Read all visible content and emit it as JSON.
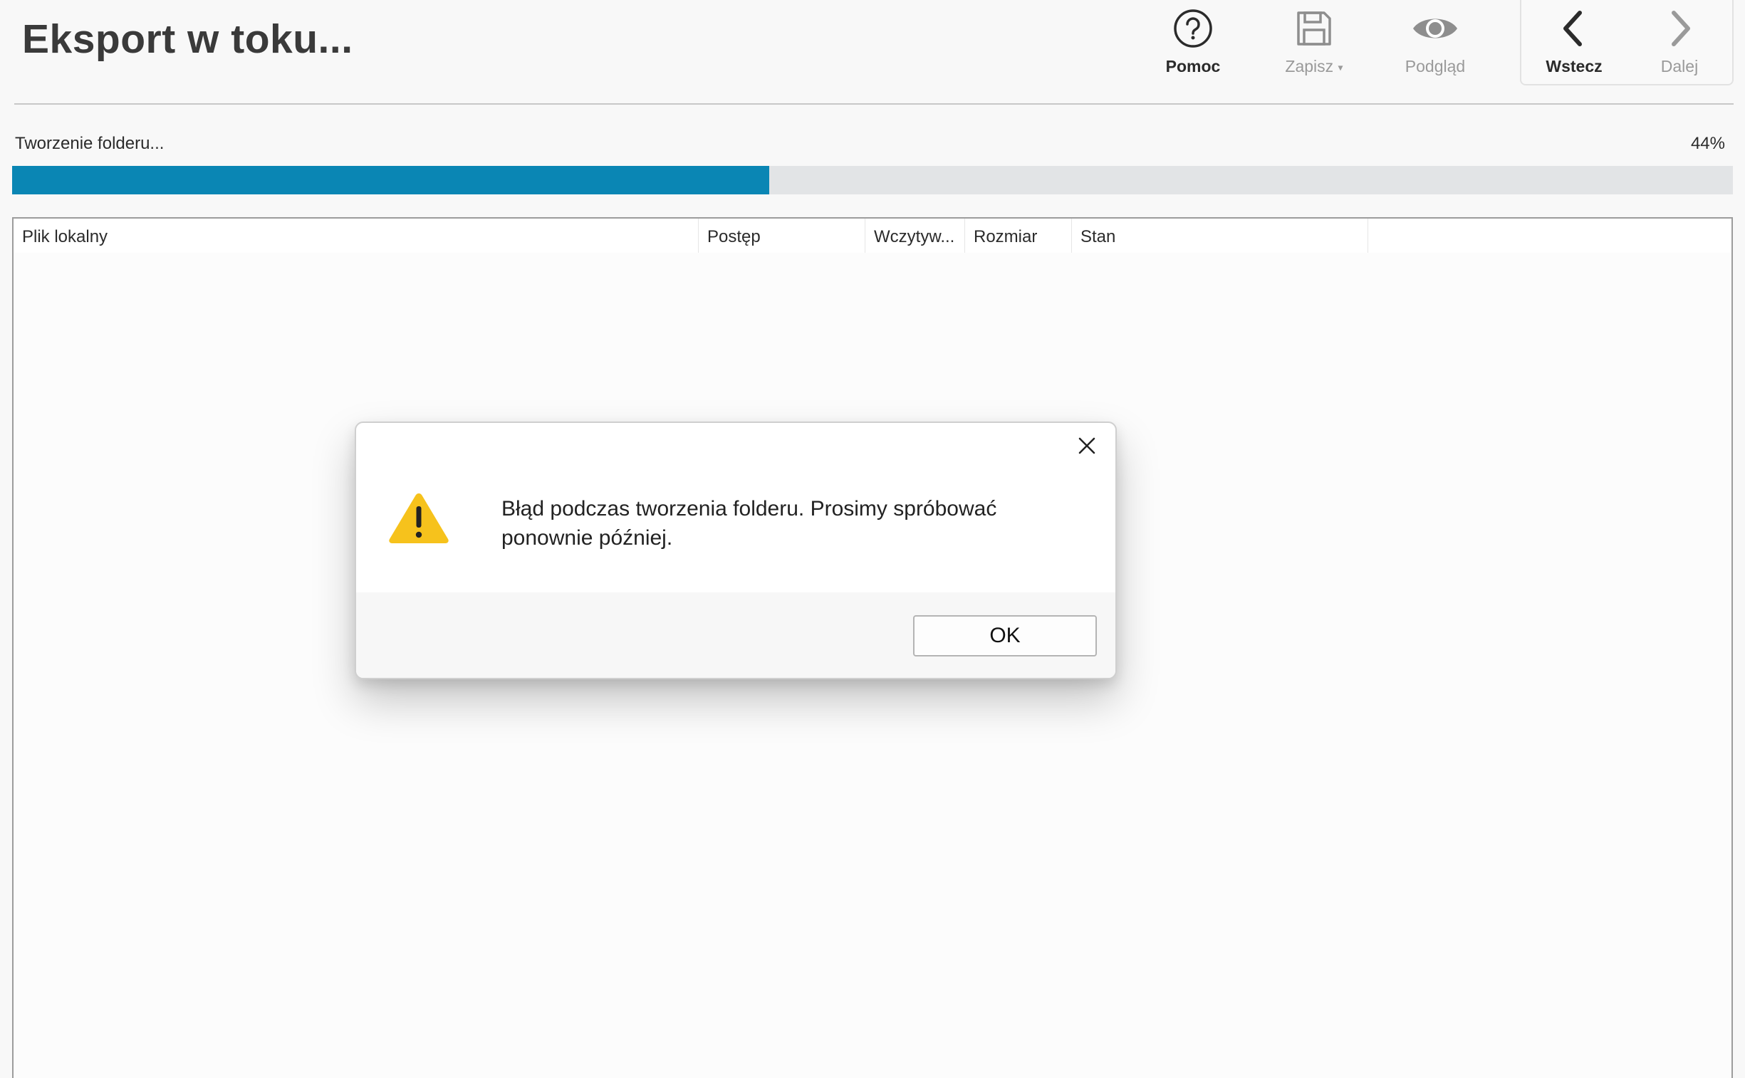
{
  "header": {
    "title": "Eksport w toku..."
  },
  "toolbar": {
    "help": {
      "label": "Pomoc",
      "icon": "question-circle-icon",
      "enabled": true
    },
    "save": {
      "label": "Zapisz",
      "icon": "floppy-disk-icon",
      "enabled": false,
      "has_dropdown": true
    },
    "preview": {
      "label": "Podgląd",
      "icon": "eye-icon",
      "enabled": false
    },
    "back": {
      "label": "Wstecz",
      "icon": "chevron-left-icon",
      "enabled": true
    },
    "next": {
      "label": "Dalej",
      "icon": "chevron-right-icon",
      "enabled": false
    }
  },
  "progress": {
    "status": "Tworzenie folderu...",
    "percent_label": "44%",
    "value": 0.44,
    "color": "#0a86b4"
  },
  "table": {
    "columns": [
      "Plik lokalny",
      "Postęp",
      "Wczytyw...",
      "Rozmiar",
      "Stan",
      ""
    ],
    "rows": []
  },
  "dialog": {
    "icon": "warning-triangle-icon",
    "message": "Błąd podczas tworzenia folderu. Prosimy spróbować ponownie później.",
    "ok_label": "OK",
    "close_icon": "close-icon"
  },
  "colors": {
    "accent": "#0a86b4",
    "warning": "#f6c21c",
    "disabled_text": "#9a9a9a"
  }
}
